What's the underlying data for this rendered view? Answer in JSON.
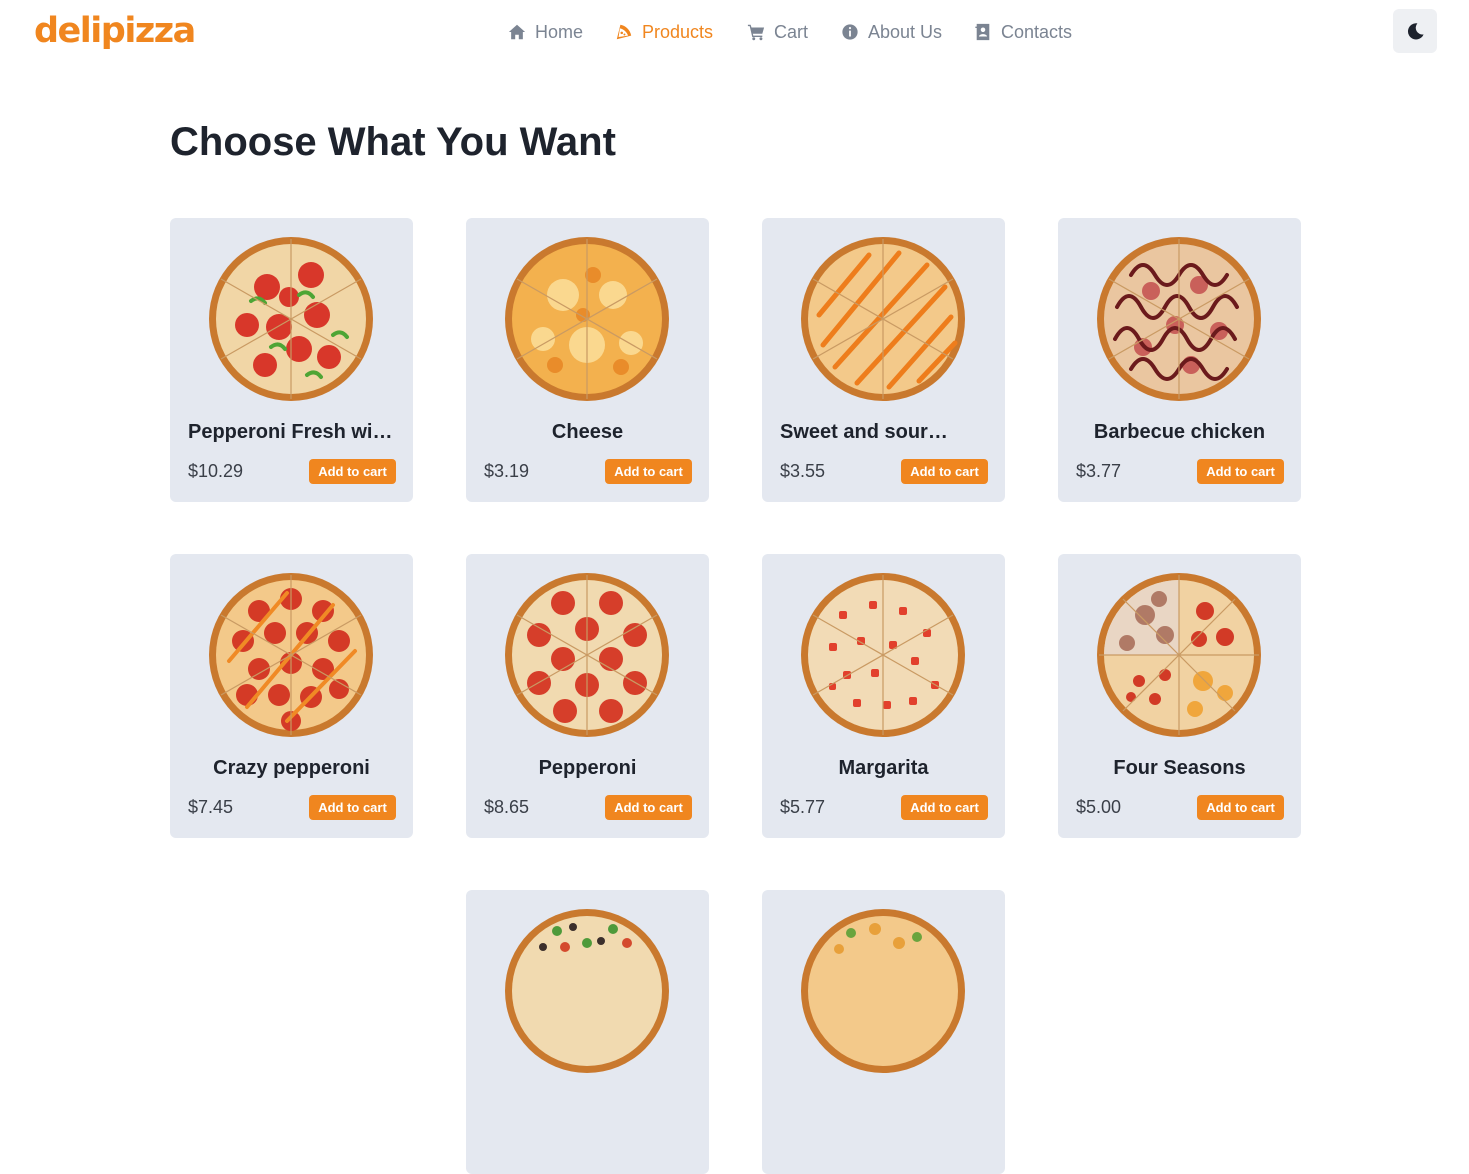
{
  "brand": {
    "logo_text": "delipizza",
    "accent_color": "#f0861f"
  },
  "nav": {
    "items": [
      {
        "label": "Home",
        "icon": "house-icon",
        "active": false
      },
      {
        "label": "Products",
        "icon": "pizza-slice-icon",
        "active": true
      },
      {
        "label": "Cart",
        "icon": "shopping-cart-icon",
        "active": false
      },
      {
        "label": "About Us",
        "icon": "info-circle-icon",
        "active": false
      },
      {
        "label": "Contacts",
        "icon": "contact-book-icon",
        "active": false
      }
    ],
    "theme_toggle_icon": "moon-icon"
  },
  "page": {
    "title": "Choose What You Want"
  },
  "products": [
    {
      "name": "Pepperoni Fresh wit…",
      "price": "$10.29",
      "button": "Add to cart",
      "topping": "pepperoni-peppers"
    },
    {
      "name": "Cheese",
      "price": "$3.19",
      "button": "Add to cart",
      "topping": "cheese"
    },
    {
      "name": "Sweet and sour…",
      "price": "$3.55",
      "button": "Add to cart",
      "topping": "sweet-sour"
    },
    {
      "name": "Barbecue chicken",
      "price": "$3.77",
      "button": "Add to cart",
      "topping": "bbq"
    },
    {
      "name": "Crazy pepperoni",
      "price": "$7.45",
      "button": "Add to cart",
      "topping": "crazy-pepperoni"
    },
    {
      "name": "Pepperoni",
      "price": "$8.65",
      "button": "Add to cart",
      "topping": "pepperoni"
    },
    {
      "name": "Margarita",
      "price": "$5.77",
      "button": "Add to cart",
      "topping": "margarita"
    },
    {
      "name": "Four Seasons",
      "price": "$5.00",
      "button": "Add to cart",
      "topping": "four-seasons"
    },
    {
      "name": "",
      "price": "",
      "button": "",
      "topping": "veggie"
    },
    {
      "name": "",
      "price": "",
      "button": "",
      "topping": "mexican"
    }
  ]
}
